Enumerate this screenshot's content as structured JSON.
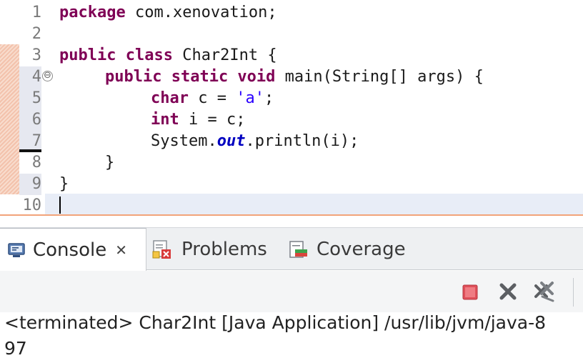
{
  "editor": {
    "line_numbers": [
      "1",
      "2",
      "3",
      "4",
      "5",
      "6",
      "7",
      "8",
      "9",
      "10"
    ],
    "lines": {
      "l1": {
        "kw": "package",
        "rest": " com.xenovation;"
      },
      "l3": {
        "kw": "public class",
        "rest": " Char2Int {"
      },
      "l4": {
        "kw": "public static void",
        "rest": " main(String[] args) {"
      },
      "l5": {
        "kw": "char",
        "mid": " c = ",
        "str": "'a'",
        "end": ";"
      },
      "l6": {
        "kw": "int",
        "rest": " i = c;"
      },
      "l7": {
        "pre": "System.",
        "field": "out",
        "rest": ".println(i);"
      },
      "l8": {
        "text": "}"
      },
      "l9": {
        "text": "}"
      }
    },
    "fold_symbol": "⊖"
  },
  "console_view": {
    "tabs": [
      {
        "label": "Console",
        "icon": "console-icon",
        "close_glyph": "✕"
      },
      {
        "label": "Problems",
        "icon": "problems-icon"
      },
      {
        "label": "Coverage",
        "icon": "coverage-icon"
      }
    ],
    "toolbar": [
      "terminate-icon",
      "remove-launch-icon",
      "remove-all-terminated-icon"
    ],
    "header_text": "<terminated> Char2Int [Java Application] /usr/lib/jvm/java-8",
    "output": "97"
  },
  "colors": {
    "keyword": "#7f0055",
    "string": "#2a00ff",
    "field": "#0000c0",
    "terminate": "#e0505a"
  }
}
